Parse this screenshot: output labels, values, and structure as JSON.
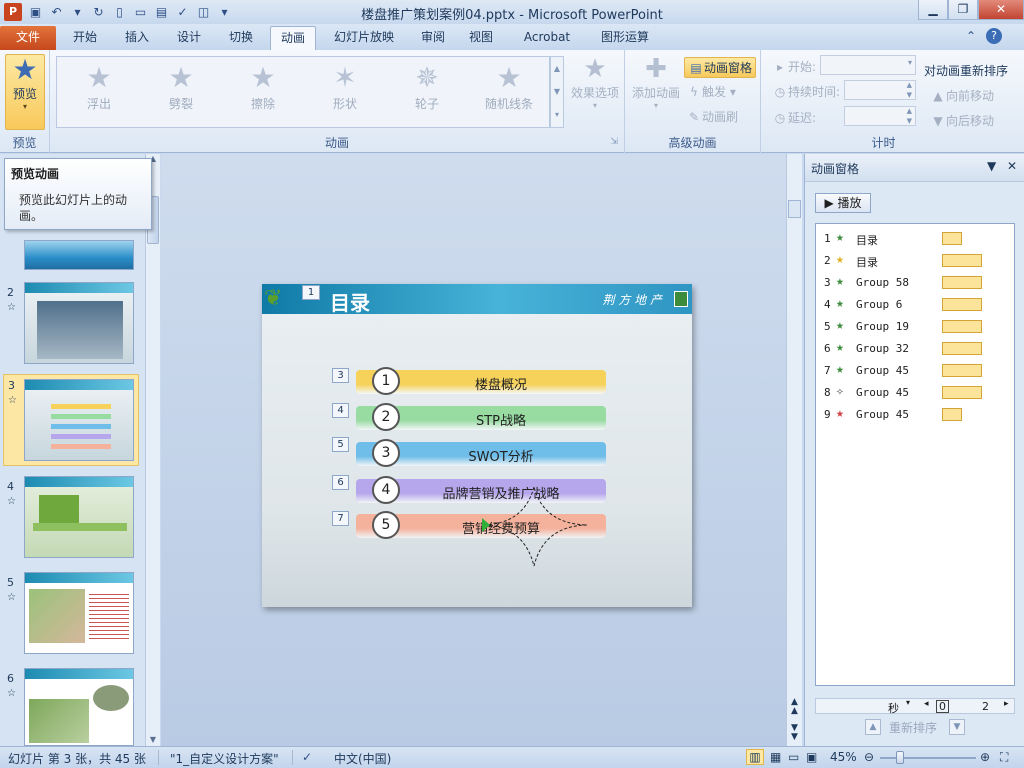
{
  "window": {
    "title": "楼盘推广策划案例04.pptx - Microsoft PowerPoint",
    "app_icon": "P"
  },
  "tabs": [
    "文件",
    "开始",
    "插入",
    "设计",
    "切换",
    "动画",
    "幻灯片放映",
    "审阅",
    "视图",
    "Acrobat",
    "图形运算"
  ],
  "active_tab": "动画",
  "ribbon": {
    "preview": {
      "label": "预览",
      "group": "预览"
    },
    "animation_group": "动画",
    "gallery": [
      "浮出",
      "劈裂",
      "擦除",
      "形状",
      "轮子",
      "随机线条"
    ],
    "effect_options": "效果选项",
    "advanced": {
      "group": "高级动画",
      "add_animation": "添加动画",
      "pane_button": "动画窗格",
      "trigger": "触发",
      "painter": "动画刷"
    },
    "timing": {
      "group": "计时",
      "start": "开始:",
      "duration": "持续时间:",
      "delay": "延迟:",
      "reorder_title": "对动画重新排序",
      "move_earlier": "向前移动",
      "move_later": "向后移动"
    }
  },
  "tooltip": {
    "title": "预览动画",
    "desc": "预览此幻灯片上的动画。"
  },
  "thumbnails": [
    {
      "num": "",
      "star": "",
      "selected": false
    },
    {
      "num": "2",
      "star": "☆",
      "selected": false
    },
    {
      "num": "3",
      "star": "☆",
      "selected": true
    },
    {
      "num": "4",
      "star": "☆",
      "selected": false
    },
    {
      "num": "5",
      "star": "☆",
      "selected": false
    },
    {
      "num": "6",
      "star": "☆",
      "selected": false
    }
  ],
  "slide": {
    "title": "目录",
    "brand": "荆 方 地 产",
    "badge": "1",
    "items": [
      {
        "tag": "3",
        "num": "1",
        "text": "楼盘概况",
        "color": "#f6d25a"
      },
      {
        "tag": "4",
        "num": "2",
        "text": "STP战略",
        "color": "#98dca2"
      },
      {
        "tag": "5",
        "num": "3",
        "text": "SWOT分析",
        "color": "#6fbde9"
      },
      {
        "tag": "6",
        "num": "4",
        "text": "品牌营销及推广战略",
        "color": "#b6a6ec"
      },
      {
        "tag": "7",
        "num": "5",
        "text": "营销经费预算",
        "color": "#f4b29c"
      }
    ]
  },
  "anim_pane": {
    "title": "动画窗格",
    "play": "播放",
    "items": [
      {
        "num": "1",
        "icon": "★",
        "icon_color": "#3c8c3c",
        "name": "目录",
        "bar": "short"
      },
      {
        "num": "2",
        "icon": "★",
        "icon_color": "#e0b020",
        "name": "目录",
        "bar": "long"
      },
      {
        "num": "3",
        "icon": "★",
        "icon_color": "#3c8c3c",
        "name": "Group 58",
        "bar": "long"
      },
      {
        "num": "4",
        "icon": "★",
        "icon_color": "#3c8c3c",
        "name": "Group 6",
        "bar": "long"
      },
      {
        "num": "5",
        "icon": "★",
        "icon_color": "#3c8c3c",
        "name": "Group 19",
        "bar": "long"
      },
      {
        "num": "6",
        "icon": "★",
        "icon_color": "#3c8c3c",
        "name": "Group 32",
        "bar": "long"
      },
      {
        "num": "7",
        "icon": "★",
        "icon_color": "#3c8c3c",
        "name": "Group 45",
        "bar": "long"
      },
      {
        "num": "8",
        "icon": "✧",
        "icon_color": "#444444",
        "name": "Group 45",
        "bar": "long"
      },
      {
        "num": "9",
        "icon": "★",
        "icon_color": "#d04040",
        "name": "Group 45",
        "bar": "short"
      }
    ],
    "timeline": {
      "unit": "秒",
      "start": "0",
      "end": "2"
    },
    "reorder": "重新排序"
  },
  "status": {
    "slide_info": "幻灯片 第 3 张，共 45 张",
    "theme": "\"1_自定义设计方案\"",
    "language": "中文(中国)",
    "zoom": "45%"
  }
}
